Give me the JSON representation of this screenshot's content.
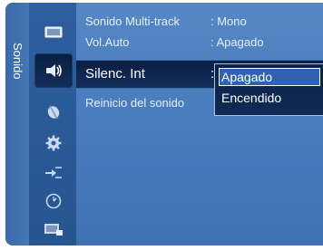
{
  "menu": {
    "category": "Sonido",
    "items": [
      {
        "label": "Sonido Multi-track",
        "value": ": Mono"
      },
      {
        "label": "Vol.Auto",
        "value": ": Apagado"
      },
      {
        "label": "Silenc. Int",
        "value": ":"
      },
      {
        "label": "Reinicio del sonido",
        "value": ""
      }
    ],
    "dropdown": {
      "options": [
        "Apagado",
        "Encendido"
      ],
      "selected": "Apagado"
    }
  },
  "icons": [
    {
      "name": "picture-icon",
      "color": "#d8e4f2"
    },
    {
      "name": "sound-icon",
      "color": "#ffffff"
    },
    {
      "name": "channel-icon",
      "color": "#c9d8ec"
    },
    {
      "name": "setup-gear-icon",
      "color": "#c9d8ec"
    },
    {
      "name": "input-icon",
      "color": "#c9d8ec"
    },
    {
      "name": "clock-icon",
      "color": "#c9d8ec"
    },
    {
      "name": "application-icon",
      "color": "#c9d8ec"
    }
  ],
  "colors": {
    "panel": "#4a7ebf",
    "icon_column": "#2a5a98",
    "highlight": "#0b1d40",
    "dropdown_selected": "#2f63b1",
    "text": "#ffffff"
  }
}
